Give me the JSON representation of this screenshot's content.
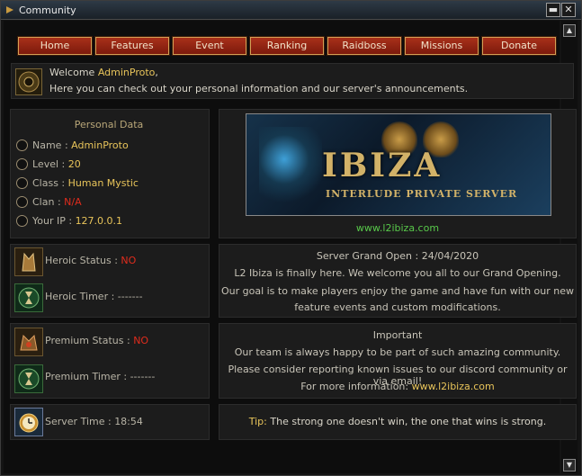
{
  "window": {
    "title": "Community"
  },
  "nav": [
    "Home",
    "Features",
    "Event",
    "Ranking",
    "Raidboss",
    "Missions",
    "Donate"
  ],
  "welcome": {
    "prefix": "Welcome ",
    "name": "AdminProto",
    "suffix": ",",
    "line2": "Here you can check out your personal information and our server's announcements."
  },
  "personal": {
    "title": "Personal Data",
    "rows": [
      {
        "label": "Name : ",
        "value": "AdminProto",
        "color": "#e8c45a"
      },
      {
        "label": "Level : ",
        "value": "20",
        "color": "#e8c45a"
      },
      {
        "label": "Class : ",
        "value": "Human Mystic",
        "color": "#e8c45a"
      },
      {
        "label": "Clan : ",
        "value": "N/A",
        "color": "#e02c1c"
      },
      {
        "label": "Your IP : ",
        "value": "127.0.0.1",
        "color": "#e8c45a"
      }
    ]
  },
  "banner": {
    "logo": "IBIZA",
    "sub": "INTERLUDE PRIVATE SERVER",
    "link": "www.l2ibiza.com"
  },
  "heroic": {
    "status_label": "Heroic Status : ",
    "status_value": "NO",
    "timer_label": "Heroic Timer : -------"
  },
  "premium": {
    "status_label": "Premium Status : ",
    "status_value": "NO",
    "timer_label": "Premium Timer : -------"
  },
  "server": {
    "time_label": "Server Time : 18:54"
  },
  "announce": {
    "title": "Server Grand Open : 24/04/2020",
    "lines": [
      "L2 Ibiza is finally here. We welcome you all to our Grand Opening.",
      "Our goal is to make players enjoy the game and have fun with our new",
      "feature events and custom modifications."
    ]
  },
  "important": {
    "title": "Important",
    "lines": [
      "Our team is always happy to be part of such amazing community.",
      "Please consider reporting known issues to our discord community or via email!"
    ],
    "info_prefix": "For more information: ",
    "info_link": "www.l2ibiza.com"
  },
  "tip": {
    "label": "Tip:",
    "text": " The strong one doesn't win, the one that wins is strong."
  }
}
